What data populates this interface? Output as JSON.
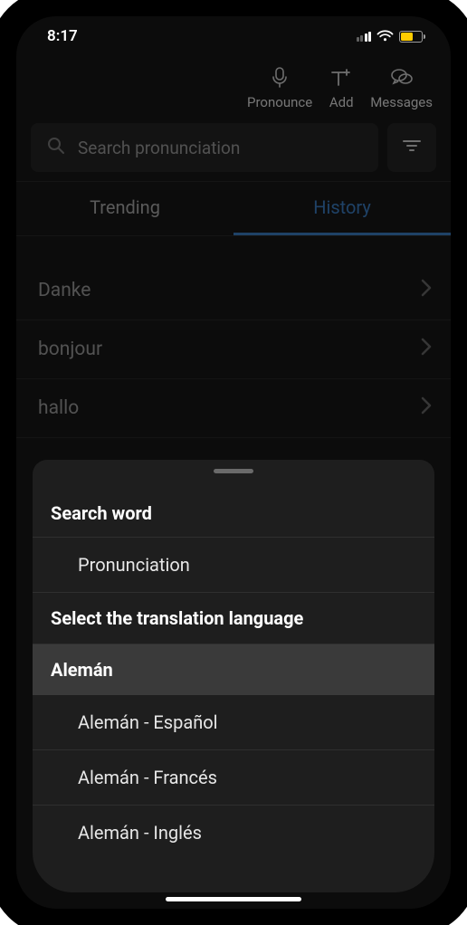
{
  "status": {
    "time": "8:17"
  },
  "toolbar": {
    "pronounce": "Pronounce",
    "add": "Add",
    "messages": "Messages"
  },
  "search": {
    "placeholder": "Search pronunciation"
  },
  "tabs": {
    "trending": "Trending",
    "history": "History"
  },
  "history": [
    "Danke",
    "bonjour",
    "hallo"
  ],
  "sheet": {
    "searchWord": "Search word",
    "pronunciation": "Pronunciation",
    "selectLang": "Select the translation language",
    "langHeader": "Alemán",
    "options": [
      "Alemán - Español",
      "Alemán - Francés",
      "Alemán - Inglés"
    ]
  }
}
